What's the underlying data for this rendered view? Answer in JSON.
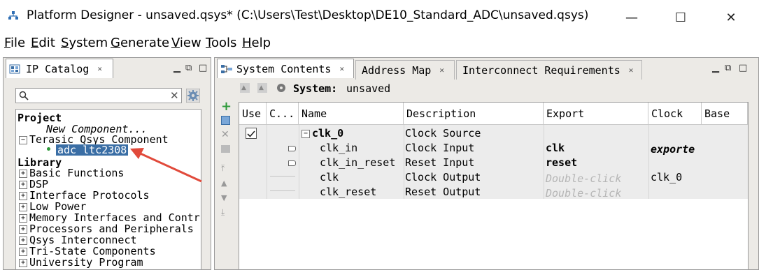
{
  "window": {
    "title": "Platform Designer - unsaved.qsys* (C:\\Users\\Test\\Desktop\\DE10_Standard_ADC\\unsaved.qsys)",
    "controls": {
      "minimize": "—",
      "maximize": "☐",
      "close": "✕"
    }
  },
  "menu": [
    {
      "first": "F",
      "rest": "ile"
    },
    {
      "first": "E",
      "rest": "dit"
    },
    {
      "first": "S",
      "rest": "ystem"
    },
    {
      "first": "G",
      "rest": "enerate"
    },
    {
      "first": "V",
      "rest": "iew"
    },
    {
      "first": "T",
      "rest": "ools"
    },
    {
      "first": "H",
      "rest": "elp"
    }
  ],
  "ip_catalog": {
    "tab_label": "IP Catalog",
    "search_placeholder": "",
    "tree": {
      "project_heading": "Project",
      "new_component": "New Component...",
      "terasic_group": "Terasic Qsys Component",
      "selected_item": "adc_ltc2308",
      "library_heading": "Library",
      "library_items": [
        "Basic Functions",
        "DSP",
        "Interface Protocols",
        "Low Power",
        "Memory Interfaces and Contr",
        "Processors and Peripherals",
        "Qsys Interconnect",
        "Tri-State Components",
        "University Program"
      ]
    }
  },
  "system_contents": {
    "tabs": [
      "System Contents",
      "Address Map",
      "Interconnect Requirements"
    ],
    "system_label": "System:",
    "system_name": "unsaved",
    "columns": [
      "Use",
      "C...",
      "Name",
      "Description",
      "Export",
      "Clock",
      "Base"
    ],
    "rows": [
      {
        "name": "clk_0",
        "description": "Clock Source",
        "export": "",
        "clock": "",
        "use_checked": true
      },
      {
        "name": "clk_in",
        "description": "Clock Input",
        "export": "clk",
        "clock": "exporte"
      },
      {
        "name": "clk_in_reset",
        "description": "Reset Input",
        "export": "reset",
        "clock": ""
      },
      {
        "name": "clk",
        "description": "Clock Output",
        "export": "Double-click",
        "clock": "clk_0"
      },
      {
        "name": "clk_reset",
        "description": "Reset Output",
        "export": "Double-click",
        "clock": ""
      }
    ]
  },
  "colors": {
    "panel_bg": "#eceae6",
    "selection": "#3a6ea5",
    "arrow": "#e14a3b",
    "add_green": "#2e9a3a"
  },
  "icons": [
    "app-icon",
    "search-icon",
    "settings-icon",
    "clear-icon",
    "add-icon",
    "remove-icon",
    "move-top-icon",
    "move-up-icon",
    "move-down-icon",
    "move-bottom-icon"
  ]
}
